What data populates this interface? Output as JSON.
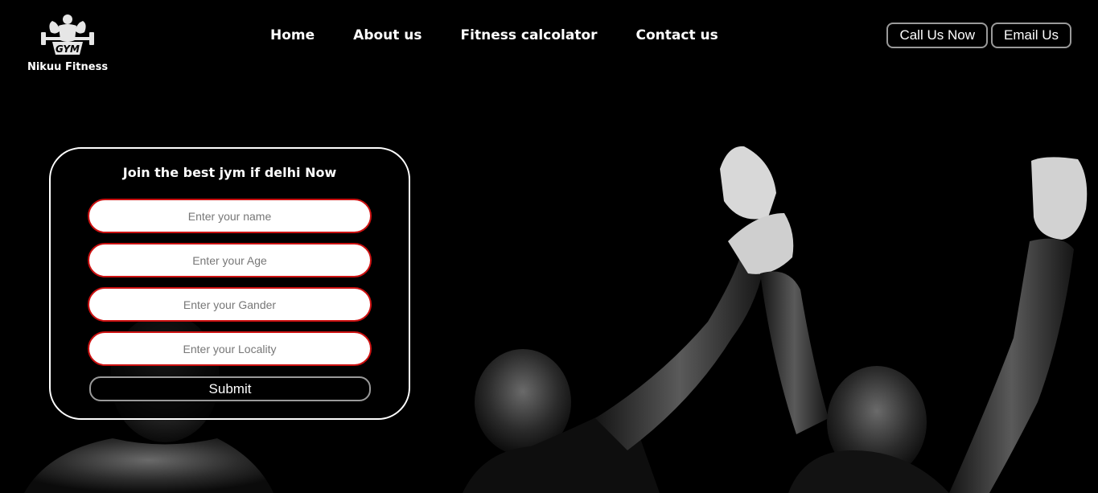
{
  "brand": {
    "name": "Nikuu Fitness",
    "logo_text": "GYM"
  },
  "nav": {
    "items": [
      "Home",
      "About us",
      "Fitness calcolator",
      "Contact us"
    ]
  },
  "header_actions": {
    "call": "Call Us Now",
    "email": "Email Us"
  },
  "form": {
    "title": "Join the best jym if delhi Now",
    "fields": [
      {
        "placeholder": "Enter your name",
        "value": ""
      },
      {
        "placeholder": "Enter your Age",
        "value": ""
      },
      {
        "placeholder": "Enter your Gander",
        "value": ""
      },
      {
        "placeholder": "Enter your Locality",
        "value": ""
      }
    ],
    "submit_label": "Submit"
  },
  "colors": {
    "background": "#000000",
    "field_border": "#cc1111",
    "button_border": "#9a9a9a",
    "text": "#ffffff"
  }
}
